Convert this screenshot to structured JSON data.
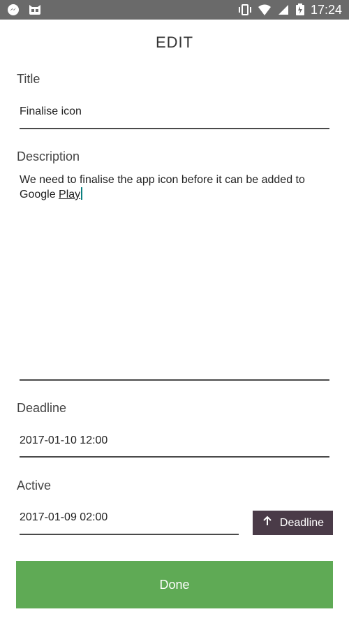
{
  "status_bar": {
    "time": "17:24",
    "left_icons": [
      "messenger-icon",
      "cat-notification-icon"
    ],
    "right_icons": [
      "vibrate-icon",
      "wifi-icon",
      "signal-icon",
      "battery-charging-icon"
    ]
  },
  "page": {
    "title": "EDIT"
  },
  "title_field": {
    "label": "Title",
    "value": "Finalise icon"
  },
  "description_field": {
    "label": "Description",
    "value_start": "We need to finalise the app icon before it can be added to Google ",
    "value_end": "Play"
  },
  "deadline_field": {
    "label": "Deadline",
    "value": "2017-01-10 12:00"
  },
  "active_field": {
    "label": "Active",
    "value": "2017-01-09 02:00"
  },
  "deadline_button": {
    "label": "Deadline",
    "icon": "arrow-up-icon"
  },
  "done_button": {
    "label": "Done"
  },
  "colors": {
    "status_bar": "#6a6a6a",
    "accent_button": "#4a3b48",
    "done_button": "#5faa55"
  }
}
